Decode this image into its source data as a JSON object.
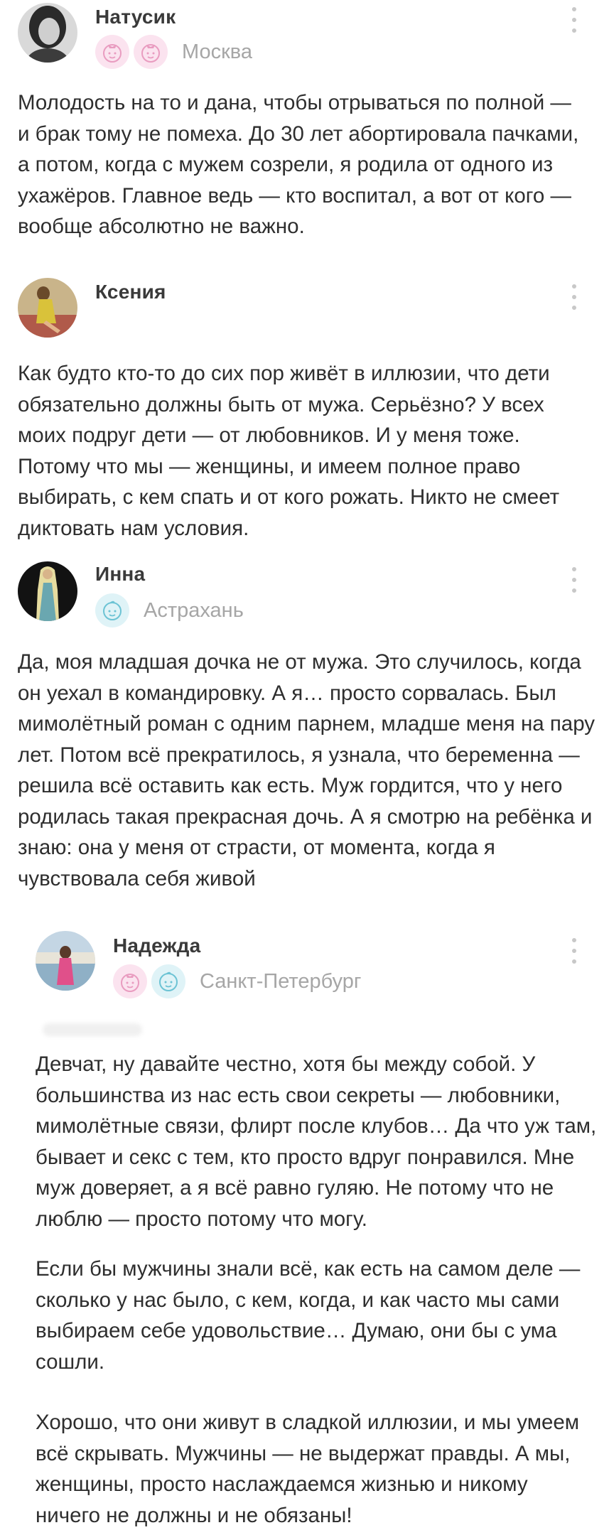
{
  "comments": [
    {
      "author": "Натусик",
      "city": "Москва",
      "badges": [
        "girl-badge-icon",
        "girl-badge-icon"
      ],
      "paragraphs": [
        "Молодость на то и дана, чтобы отрываться по полной — и брак тому не помеха. До 30 лет абортировала пачками, а потом, когда с мужем созрели, я родила от одного из ухажёров. Главное ведь — кто воспитал, а вот от кого — вообще абсолютно не важно."
      ]
    },
    {
      "author": "Ксения",
      "city": "",
      "badges": [],
      "paragraphs": [
        "Как будто кто-то до сих пор живёт в иллюзии, что дети обязательно должны быть от мужа. Серьёзно? У всех моих подруг дети — от любовников. И у меня тоже. Потому что мы — женщины, и имеем полное право выбирать, с кем спать и от кого рожать. Никто не смеет диктовать нам условия."
      ]
    },
    {
      "author": "Инна",
      "city": "Астрахань",
      "badges": [
        "boy-badge-icon"
      ],
      "paragraphs": [
        "Да, моя младшая дочка не от мужа. Это случилось, когда он уехал в командировку. А я… просто сорвалась. Был мимолётный роман с одним парнем, младше меня на пару лет. Потом всё прекратилось, я узнала, что беременна — решила всё оставить как есть. Муж гордится, что у него родилась такая прекрасная дочь. А я смотрю на ребёнка и знаю: она у меня от страсти, от момента, когда я чувствовала себя живой"
      ]
    },
    {
      "author": "Надежда",
      "city": "Санкт-Петербург",
      "badges": [
        "girl-badge-icon",
        "boy-badge-icon"
      ],
      "paragraphs": [
        "Девчат, ну давайте честно, хотя бы между собой. У большинства из нас есть свои секреты — любовники, мимолётные связи, флирт после клубов… Да что уж там, бывает и секс с тем, кто просто вдруг понравился. Мне муж доверяет, а я всё равно гуляю. Не потому что не люблю — просто потому что могу.",
        "Если бы мужчины знали всё, как есть на самом деле — сколько у нас было, с кем, когда, и как часто мы сами выбираем себе удовольствие… Думаю, они бы с ума сошли.",
        "Хорошо, что они живут в сладкой иллюзии, и мы умеем всё скрывать. Мужчины — не выдержат правды. А мы, женщины, просто наслаждаемся жизнью и никому ничего не должны и не обязаны!"
      ]
    }
  ],
  "colors": {
    "author": "#3a3a3a",
    "body_text": "#2e2e2e",
    "city": "#a6a6a6",
    "menu_dots": "#c8c8c8",
    "girl_badge_bg": "#fbe3ef",
    "boy_badge_bg": "#dff3f7"
  }
}
